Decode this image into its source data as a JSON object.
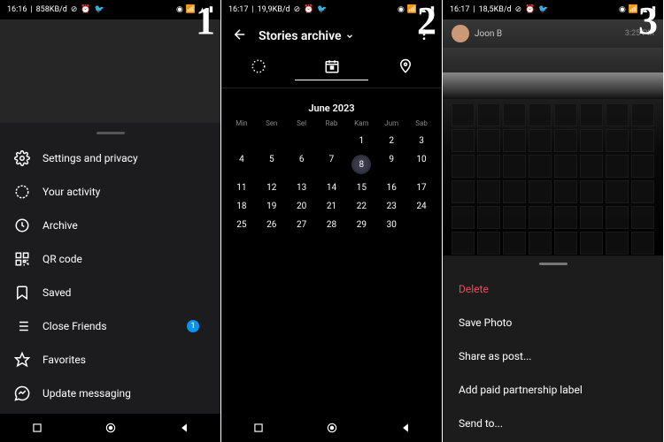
{
  "panels": [
    {
      "status": {
        "time": "16:16",
        "net": "858KB/d",
        "icons": [
          "alarm-off",
          "twitter",
          "vpn",
          "dotted",
          "wifi",
          "signal",
          "battery"
        ]
      },
      "num": "1",
      "menu": [
        {
          "icon": "gear",
          "label": "Settings and privacy"
        },
        {
          "icon": "activity",
          "label": "Your activity"
        },
        {
          "icon": "clock",
          "label": "Archive"
        },
        {
          "icon": "qr",
          "label": "QR code"
        },
        {
          "icon": "bookmark",
          "label": "Saved"
        },
        {
          "icon": "list",
          "label": "Close Friends",
          "badge": "1"
        },
        {
          "icon": "star",
          "label": "Favorites"
        },
        {
          "icon": "messenger",
          "label": "Update messaging"
        }
      ]
    },
    {
      "status": {
        "time": "16:17",
        "net": "19,9KB/d",
        "icons": [
          "alarm-off",
          "twitter",
          "vpn",
          "dotted",
          "wifi",
          "signal",
          "battery"
        ]
      },
      "num": "2",
      "header": {
        "title": "Stories archive"
      },
      "calendar": {
        "month": "June 2023",
        "dow": [
          "Min",
          "Sen",
          "Sel",
          "Rab",
          "Kam",
          "Jum",
          "Sab"
        ],
        "offset": 4,
        "days": 30,
        "today": 8
      }
    },
    {
      "status": {
        "time": "16:17",
        "net": "18,5KB/d",
        "icons": [
          "alarm-off",
          "twitter",
          "vpn",
          "dotted",
          "wifi",
          "signal",
          "battery"
        ]
      },
      "num": "3",
      "storyHeader": {
        "user": "Joon B",
        "time": "3:25 PM"
      },
      "sheet": [
        {
          "label": "Delete",
          "danger": true
        },
        {
          "label": "Save Photo"
        },
        {
          "label": "Share as post..."
        },
        {
          "label": "Add paid partnership label"
        },
        {
          "label": "Send to..."
        }
      ]
    }
  ]
}
